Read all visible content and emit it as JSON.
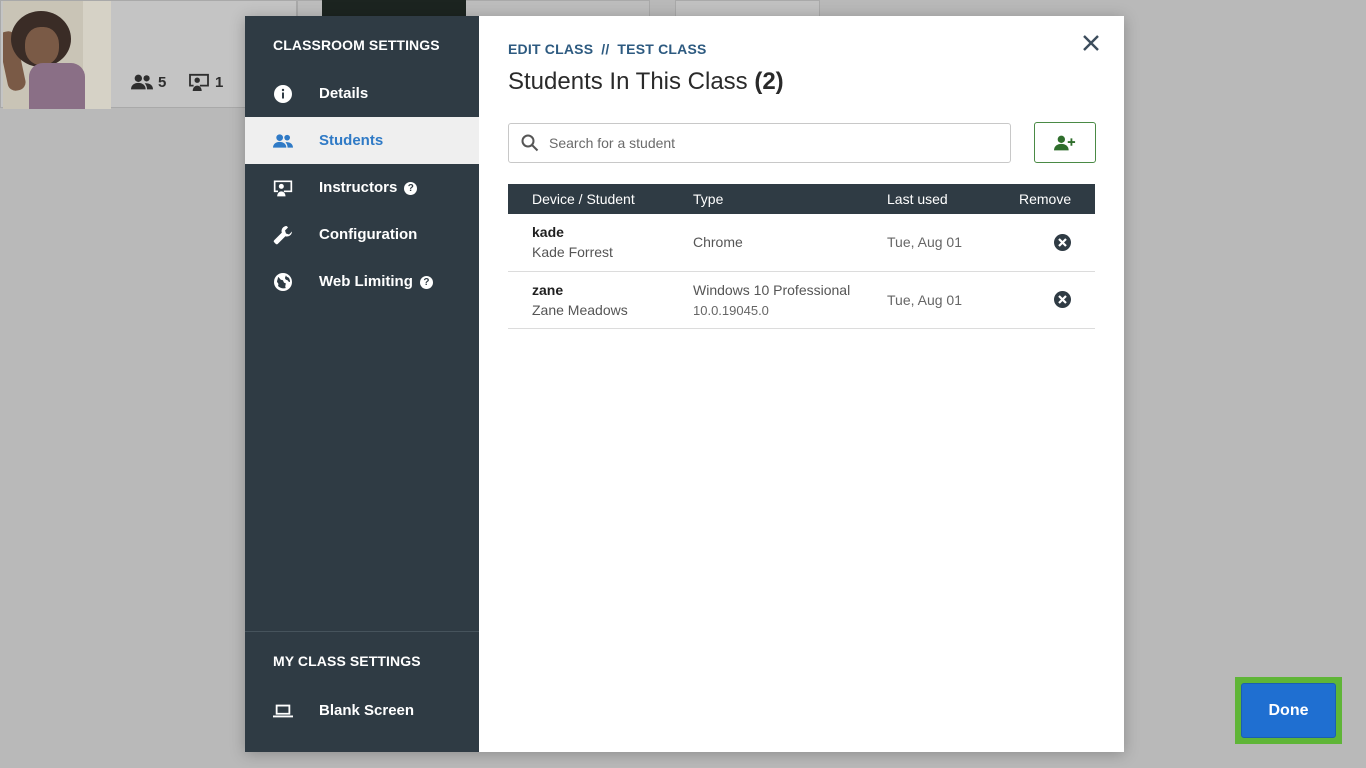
{
  "background": {
    "student_count": "5",
    "instructor_count": "1"
  },
  "sidebar": {
    "heading": "CLASSROOM SETTINGS",
    "items": [
      {
        "label": "Details",
        "icon": "info-icon",
        "help": false
      },
      {
        "label": "Students",
        "icon": "people-icon",
        "help": false,
        "active": true
      },
      {
        "label": "Instructors",
        "icon": "instructor-icon",
        "help": true
      },
      {
        "label": "Configuration",
        "icon": "wrench-icon",
        "help": false
      },
      {
        "label": "Web Limiting",
        "icon": "globe-icon",
        "help": true
      }
    ],
    "bottom_heading": "MY CLASS SETTINGS",
    "bottom_items": [
      {
        "label": "Blank Screen",
        "icon": "laptop-icon"
      }
    ],
    "help_glyph": "?"
  },
  "main": {
    "breadcrumb": {
      "first": "EDIT CLASS",
      "separator": "//",
      "second": "TEST CLASS"
    },
    "title": "Students In This Class",
    "title_count": "(2)",
    "search": {
      "placeholder": "Search for a student",
      "value": ""
    },
    "table": {
      "headers": [
        "Device / Student",
        "Type",
        "Last used",
        "Remove"
      ],
      "rows": [
        {
          "device": "kade",
          "student": "Kade Forrest",
          "type": "Chrome",
          "type_detail": "",
          "last_used": "Tue, Aug 01"
        },
        {
          "device": "zane",
          "student": "Zane Meadows",
          "type": "Windows 10 Professional",
          "type_detail": "10.0.19045.0",
          "last_used": "Tue, Aug 01"
        }
      ]
    },
    "done_label": "Done"
  },
  "colors": {
    "sidebar_bg": "#2f3b44",
    "active_accent": "#2f7ac6",
    "done_button": "#1f6fd1",
    "highlight": "#5fb537",
    "breadcrumb": "#2d5a80"
  }
}
